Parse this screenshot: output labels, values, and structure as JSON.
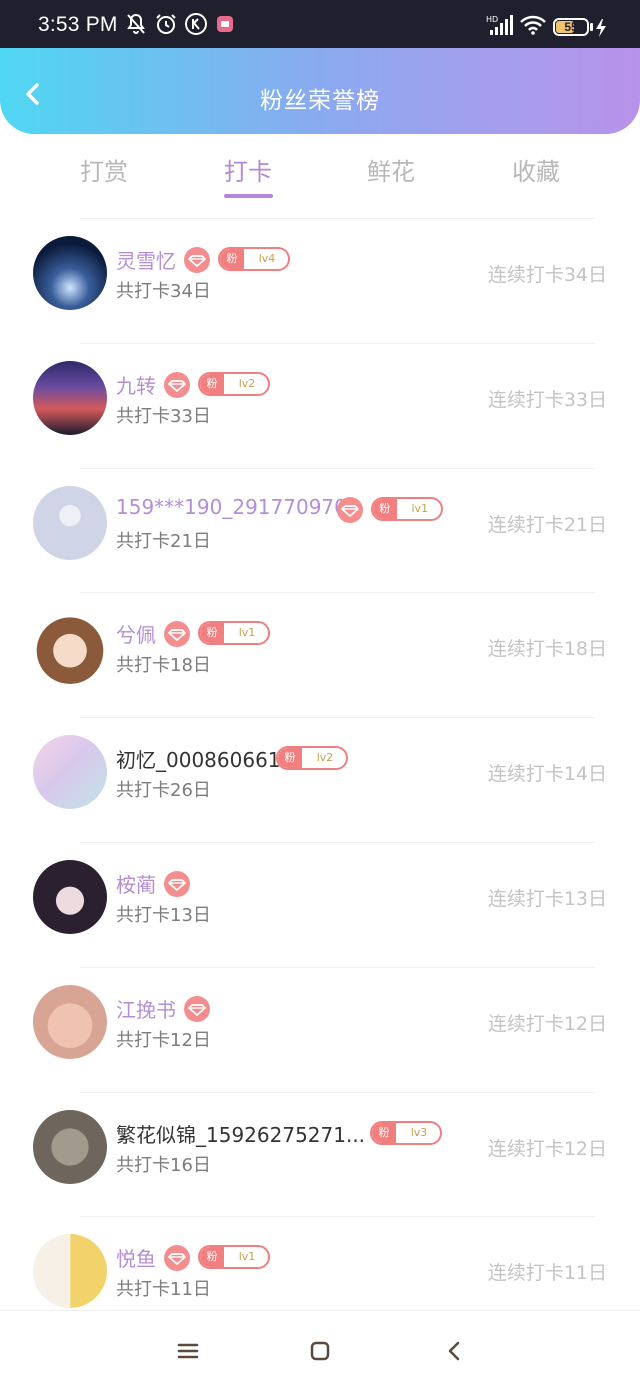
{
  "status_bar": {
    "time": "3:53 PM",
    "battery": "55",
    "icons": [
      "mute-bell-icon",
      "alarm-icon",
      "k-app-icon",
      "app-notification-icon",
      "hd-signal-icon",
      "wifi-icon",
      "battery-icon",
      "charging-bolt-icon"
    ]
  },
  "header": {
    "title": "粉丝荣誉榜",
    "back_icon": "chevron-left-icon"
  },
  "tabs": [
    {
      "label": "打赏"
    },
    {
      "label": "打卡"
    },
    {
      "label": "鲜花"
    },
    {
      "label": "收藏"
    }
  ],
  "active_tab": "打卡",
  "colors": {
    "accent_purple": "#b488d8",
    "header_gradient_start": "#4fd7f2",
    "header_gradient_end": "#b992ea",
    "badge_red": "#f17f7f",
    "level_gold": "#c9a048"
  },
  "fans": [
    {
      "name": "灵雪忆",
      "total": "共打卡34日",
      "streak": "连续打卡34日",
      "diamond": true,
      "fan_label": "粉",
      "level": "lv4",
      "name_style": "purple"
    },
    {
      "name": "九转",
      "total": "共打卡33日",
      "streak": "连续打卡33日",
      "diamond": true,
      "fan_label": "粉",
      "level": "lv2",
      "name_style": "purple"
    },
    {
      "name": "159***190_291770970",
      "total": "共打卡21日",
      "streak": "连续打卡21日",
      "diamond": true,
      "fan_label": "粉",
      "level": "lv1",
      "name_style": "purple"
    },
    {
      "name": "兮佩",
      "total": "共打卡18日",
      "streak": "连续打卡18日",
      "diamond": true,
      "fan_label": "粉",
      "level": "lv1",
      "name_style": "purple"
    },
    {
      "name": "初忆_000860661",
      "total": "共打卡26日",
      "streak": "连续打卡14日",
      "diamond": false,
      "fan_label": "粉",
      "level": "lv2",
      "name_style": "dark"
    },
    {
      "name": "桉蔺",
      "total": "共打卡13日",
      "streak": "连续打卡13日",
      "diamond": true,
      "fan_label": "",
      "level": "",
      "name_style": "purple"
    },
    {
      "name": "江挽书",
      "total": "共打卡12日",
      "streak": "连续打卡12日",
      "diamond": true,
      "fan_label": "",
      "level": "",
      "name_style": "purple"
    },
    {
      "name": "繁花似锦_15926275271...",
      "total": "共打卡16日",
      "streak": "连续打卡12日",
      "diamond": false,
      "fan_label": "粉",
      "level": "lv3",
      "name_style": "dark"
    },
    {
      "name": "悦鱼",
      "total": "共打卡11日",
      "streak": "连续打卡11日",
      "diamond": true,
      "fan_label": "粉",
      "level": "lv1",
      "name_style": "purple"
    }
  ],
  "navbar": {
    "icons": [
      "menu-icon",
      "home-square-icon",
      "back-triangle-icon"
    ]
  }
}
